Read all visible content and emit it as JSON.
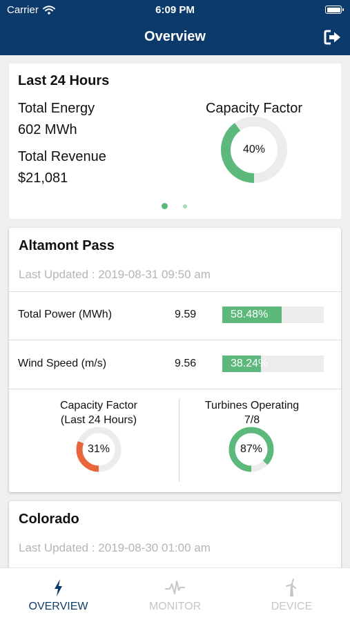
{
  "status_bar": {
    "carrier": "Carrier",
    "time": "6:09 PM"
  },
  "nav": {
    "title": "Overview"
  },
  "summary": {
    "title": "Last 24 Hours",
    "total_energy_label": "Total Energy",
    "total_energy_value": "602 MWh",
    "total_revenue_label": "Total Revenue",
    "total_revenue_value": "$21,081",
    "capacity_factor_label": "Capacity Factor",
    "capacity_factor_text": "40%",
    "capacity_factor_value": 40,
    "page_count": 2,
    "current_page": 1
  },
  "sites": [
    {
      "name": "Altamont Pass",
      "last_updated": "Last Updated : 2019-08-31 09:50 am",
      "total_power_label": "Total Power (MWh)",
      "total_power_value": "9.59",
      "total_power_pct_text": "58.48%",
      "total_power_pct": 58.48,
      "wind_speed_label": "Wind Speed (m/s)",
      "wind_speed_value": "9.56",
      "wind_speed_pct_text": "38.24%",
      "wind_speed_pct": 38.24,
      "capacity_label_line1": "Capacity Factor",
      "capacity_label_line2": "(Last 24 Hours)",
      "capacity_text": "31%",
      "capacity_value": 31,
      "turbines_label_line1": "Turbines Operating",
      "turbines_label_line2": "7/8",
      "turbines_text": "87%",
      "turbines_value": 87
    },
    {
      "name": "Colorado",
      "last_updated": "Last Updated : 2019-08-30 01:00 am"
    }
  ],
  "tabs": [
    {
      "label": "OVERVIEW",
      "icon": "lightning-icon",
      "active": true
    },
    {
      "label": "MONITOR",
      "icon": "pulse-icon",
      "active": false
    },
    {
      "label": "DEVICE",
      "icon": "wind-turbine-icon",
      "active": false
    }
  ],
  "colors": {
    "nav_bg": "#0c3a6b",
    "green": "#5cb97b",
    "orange": "#e8663c",
    "track": "#ececec"
  }
}
